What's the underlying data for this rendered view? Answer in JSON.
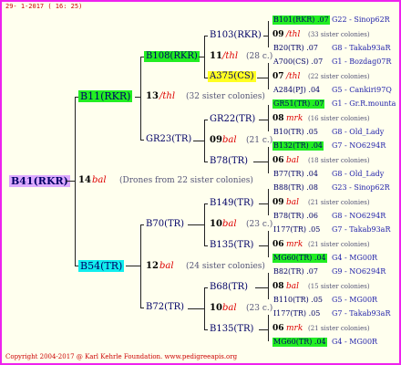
{
  "header": {
    "date": "29- 1-2017 ( 16: 25)"
  },
  "footer": {
    "copyright": "Copyright 2004-2017 @ Karl Kehrle Foundation.   www.pedigreeapis.org"
  },
  "colors": {
    "border": "#ee22ee",
    "lilac": "#ddaaff",
    "green": "#22ee22",
    "cyan": "#11eeee",
    "yellow": "#ffff22",
    "red": "#dd0000"
  },
  "root": {
    "id": "B41(RKR)",
    "count": "14",
    "type": "bal",
    "note": "(Drones from 22 sister colonies)"
  },
  "g1": [
    {
      "id": "B11(RKR)",
      "count": "13",
      "type": "/thl",
      "note": "(32 sister colonies)"
    },
    {
      "id": "B54(TR)",
      "count": "12",
      "type": "bal",
      "note": "(24 sister colonies)"
    }
  ],
  "g2": [
    {
      "id": "B108(RKR)",
      "count": "11",
      "type": "/thl",
      "note": "(28 c.)"
    },
    {
      "id": "GR23(TR)",
      "count": "09",
      "type": "bal",
      "note": "(21 c.)"
    },
    {
      "id": "B70(TR)",
      "count": "10",
      "type": "bal",
      "note": "(23 c.)"
    },
    {
      "id": "B72(TR)",
      "count": "10",
      "type": "bal",
      "note": "(23 c.)"
    }
  ],
  "g3": [
    {
      "id": "B103(RKR)",
      "count": "09",
      "type": "/thl",
      "note": "(33 sister colonies)",
      "a": "B101(RKR) .07",
      "a_r": "G22 - Sinop62R",
      "b": "B20(TR) .07",
      "b_r": "G8 - Takab93aR"
    },
    {
      "id": "A375(CS)",
      "count": "07",
      "type": "/thl",
      "note": "(22 sister colonies)",
      "a": "A700(CS) .07",
      "a_r": "G1 - Bozdag07R",
      "b": "A284(PJ) .04",
      "b_r": "G5 - Cankiri97Q"
    },
    {
      "id": "GR22(TR)",
      "count": "08",
      "type": "mrk",
      "note": "(16 sister colonies)",
      "a": "GR51(TR) .07",
      "a_r": "G1 - Gr.R.mounta",
      "b": "B10(TR) .05",
      "b_r": "G8 - Old_Lady"
    },
    {
      "id": "B78(TR)",
      "count": "06",
      "type": "bal",
      "note": "(18 sister colonies)",
      "a": "B132(TR) .04",
      "a_r": "G7 - NO6294R",
      "b": "B77(TR) .04",
      "b_r": "G8 - Old_Lady"
    },
    {
      "id": "B149(TR)",
      "count": "09",
      "type": "bal",
      "note": "(21 sister colonies)",
      "a": "B88(TR) .08",
      "a_r": "G23 - Sinop62R",
      "b": "B78(TR) .06",
      "b_r": "G8 - NO6294R"
    },
    {
      "id": "B135(TR)",
      "count": "06",
      "type": "mrk",
      "note": "(21 sister colonies)",
      "a": "I177(TR) .05",
      "a_r": "G7 - Takab93aR",
      "b": "MG60(TR) .04",
      "b_r": "G4 - MG00R"
    },
    {
      "id": "B68(TR)",
      "count": "08",
      "type": "bal",
      "note": "(15 sister colonies)",
      "a": "B82(TR) .07",
      "a_r": "G9 - NO6294R",
      "b": "B110(TR) .05",
      "b_r": "G5 - MG00R"
    },
    {
      "id": "B135(TR)",
      "count": "06",
      "type": "mrk",
      "note": "(21 sister colonies)",
      "a": "I177(TR) .05",
      "a_r": "G7 - Takab93aR",
      "b": "MG60(TR) .04",
      "b_r": "G4 - MG00R"
    }
  ]
}
